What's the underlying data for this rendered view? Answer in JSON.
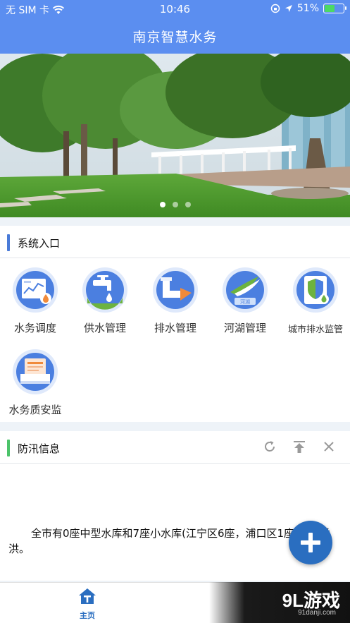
{
  "status_bar": {
    "carrier": "无 SIM 卡",
    "time": "10:46",
    "battery_percent": "51%",
    "battery_level": 0.51
  },
  "nav": {
    "title": "南京智慧水务"
  },
  "banner": {
    "slide_count": 3,
    "active_slide": 1
  },
  "system_section": {
    "title": "系统入口",
    "accent_color": "#4a7bd8",
    "items": [
      {
        "label": "水务调度",
        "icon": "dispatch-monitor-icon"
      },
      {
        "label": "供水管理",
        "icon": "water-tap-icon"
      },
      {
        "label": "排水管理",
        "icon": "drainage-pipe-icon"
      },
      {
        "label": "河湖管理",
        "icon": "river-lake-icon"
      },
      {
        "label": "城市排水监管",
        "icon": "shield-drainage-icon"
      },
      {
        "label": "水务质安监",
        "icon": "quality-inspection-icon"
      }
    ]
  },
  "flood_section": {
    "title": "防汛信息",
    "accent_color": "#4cc36a",
    "text": "全市有0座中型水库和7座小水库(江宁区6座，浦口区1座)正常溢洪。"
  },
  "tab_bar": {
    "home_label": "主页"
  },
  "watermark": {
    "brand": "9L游戏",
    "url": "91danji.com"
  }
}
